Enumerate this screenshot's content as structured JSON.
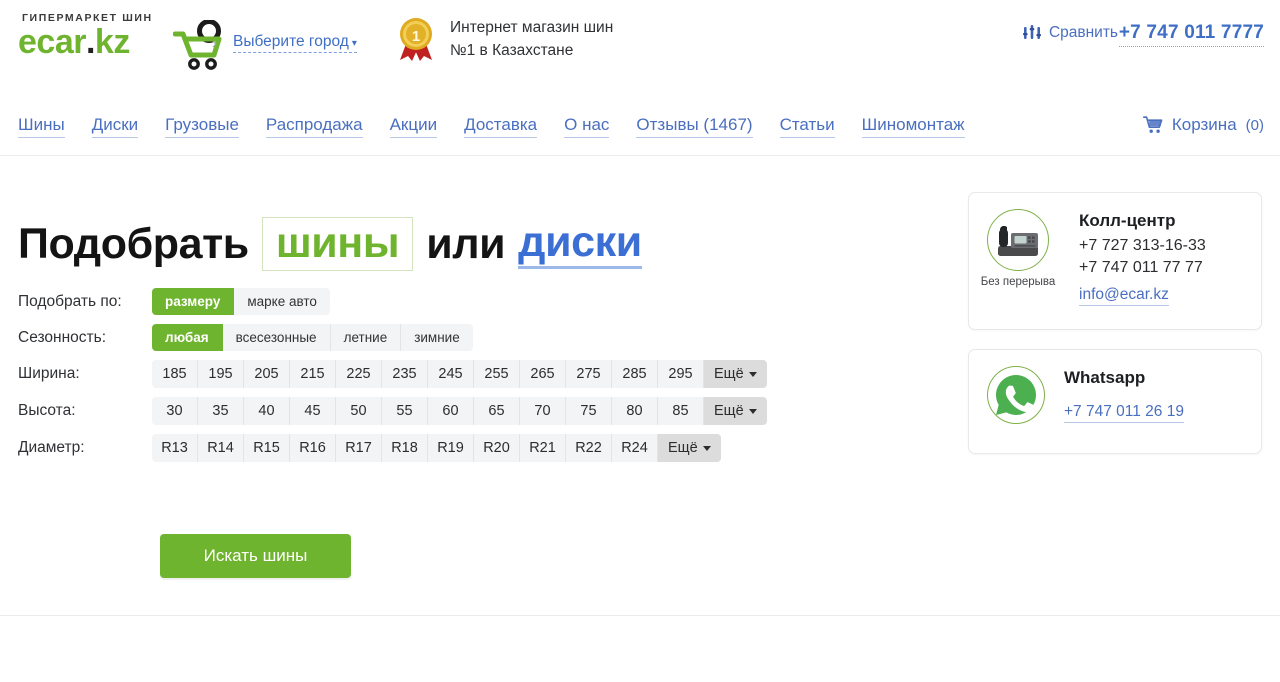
{
  "header": {
    "logo": {
      "tagline": "ГИПЕРМАРКЕТ ШИН",
      "name_part1": "ecar",
      "dot": ".",
      "name_part2": "kz",
      "cart_icon": "shopping-cart-icon"
    },
    "city_selector": {
      "label": "Выберите город",
      "caret": "▾"
    },
    "badge": {
      "icon": "award-medal-icon",
      "line1": "Интернет магазин шин",
      "line2": "№1 в Казахстане"
    },
    "compare": {
      "icon": "equalizer-icon",
      "label": "Сравнить"
    },
    "phone": "+7 747 011 7777"
  },
  "nav": {
    "items": [
      {
        "label": "Шины"
      },
      {
        "label": "Диски"
      },
      {
        "label": "Грузовые"
      },
      {
        "label": "Распродажа"
      },
      {
        "label": "Акции"
      },
      {
        "label": "Доставка"
      },
      {
        "label": "О нас"
      },
      {
        "label": "Отзывы (1467)"
      },
      {
        "label": "Статьи"
      },
      {
        "label": "Шиномонтаж"
      }
    ],
    "cart": {
      "icon": "cart-icon",
      "label": "Корзина",
      "count": "(0)"
    }
  },
  "hero": {
    "word1": "Подобрать",
    "word2": "шины",
    "word3": "или",
    "word4": "диски"
  },
  "form": {
    "rows": [
      {
        "id": "search-by",
        "label": "Подобрать по:",
        "type": "segmented",
        "options": [
          {
            "label": "размеру",
            "active": true
          },
          {
            "label": "марке авто",
            "active": false
          }
        ]
      },
      {
        "id": "season",
        "label": "Сезонность:",
        "type": "segmented",
        "options": [
          {
            "label": "любая",
            "active": true
          },
          {
            "label": "всесезонные",
            "active": false
          },
          {
            "label": "летние",
            "active": false
          },
          {
            "label": "зимние",
            "active": false
          }
        ]
      },
      {
        "id": "width",
        "label": "Ширина:",
        "type": "sizes",
        "options": [
          {
            "label": "185",
            "active": false
          },
          {
            "label": "195",
            "active": false
          },
          {
            "label": "205",
            "active": false
          },
          {
            "label": "215",
            "active": false
          },
          {
            "label": "225",
            "active": false
          },
          {
            "label": "235",
            "active": false
          },
          {
            "label": "245",
            "active": false
          },
          {
            "label": "255",
            "active": false
          },
          {
            "label": "265",
            "active": false
          },
          {
            "label": "275",
            "active": false
          },
          {
            "label": "285",
            "active": false
          },
          {
            "label": "295",
            "active": false
          }
        ],
        "more_label": "Ещё"
      },
      {
        "id": "height",
        "label": "Высота:",
        "type": "sizes",
        "options": [
          {
            "label": "30",
            "active": false
          },
          {
            "label": "35",
            "active": false
          },
          {
            "label": "40",
            "active": false
          },
          {
            "label": "45",
            "active": false
          },
          {
            "label": "50",
            "active": false
          },
          {
            "label": "55",
            "active": false
          },
          {
            "label": "60",
            "active": false
          },
          {
            "label": "65",
            "active": false
          },
          {
            "label": "70",
            "active": false
          },
          {
            "label": "75",
            "active": false
          },
          {
            "label": "80",
            "active": false
          },
          {
            "label": "85",
            "active": false
          }
        ],
        "more_label": "Ещё"
      },
      {
        "id": "diameter",
        "label": "Диаметр:",
        "type": "sizes",
        "options": [
          {
            "label": "R13",
            "active": false
          },
          {
            "label": "R14",
            "active": false
          },
          {
            "label": "R15",
            "active": false
          },
          {
            "label": "R16",
            "active": false
          },
          {
            "label": "R17",
            "active": false
          },
          {
            "label": "R18",
            "active": false
          },
          {
            "label": "R19",
            "active": false
          },
          {
            "label": "R20",
            "active": false
          },
          {
            "label": "R21",
            "active": false
          },
          {
            "label": "R22",
            "active": false
          },
          {
            "label": "R24",
            "active": false
          }
        ],
        "more_label": "Ещё"
      }
    ],
    "submit_label": "Искать шины"
  },
  "sidebar": {
    "call_center": {
      "icon": "desk-phone-icon",
      "caption": "Без перерыва",
      "title": "Колл-центр",
      "phone1": "+7 727 313-16-33",
      "phone2": "+7 747 011 77 77",
      "email": "info@ecar.kz"
    },
    "whatsapp": {
      "icon": "whatsapp-icon",
      "title": "Whatsapp",
      "phone": "+7 747 011 26 19"
    }
  },
  "colors": {
    "brand_green": "#6fb42e",
    "link_blue": "#4a6fc0",
    "heading_blue": "#3b6fd4",
    "chip_bg": "#f3f4f5",
    "more_bg": "#dcdcdc"
  }
}
